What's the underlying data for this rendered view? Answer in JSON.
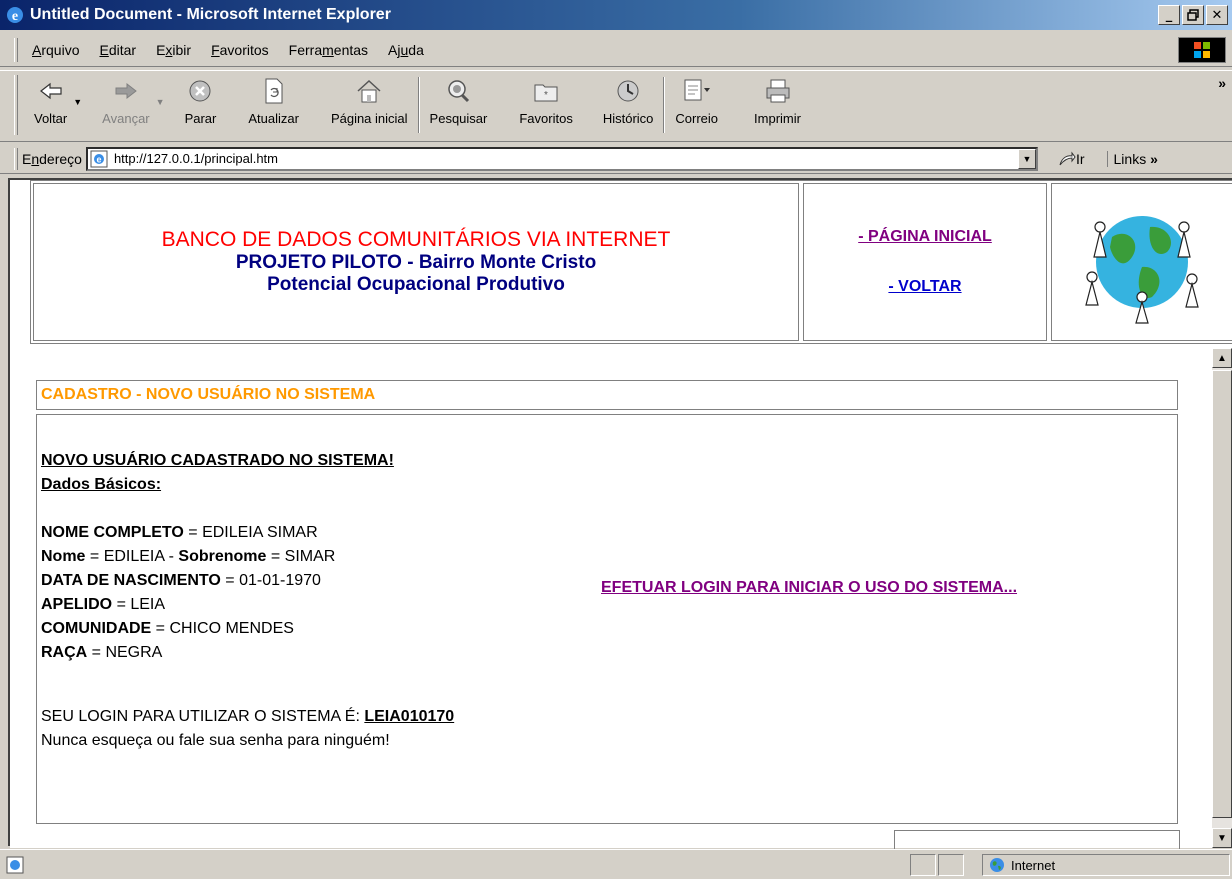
{
  "window": {
    "title": "Untitled Document - Microsoft Internet Explorer",
    "buttons": [
      "_",
      "🗗",
      "X"
    ]
  },
  "menu": {
    "items": [
      {
        "pre": "",
        "u": "A",
        "post": "rquivo"
      },
      {
        "pre": "",
        "u": "E",
        "post": "ditar"
      },
      {
        "pre": "E",
        "u": "x",
        "post": "ibir"
      },
      {
        "pre": "",
        "u": "F",
        "post": "avoritos"
      },
      {
        "pre": "Ferra",
        "u": "m",
        "post": "entas"
      },
      {
        "pre": "Aj",
        "u": "u",
        "post": "da"
      }
    ]
  },
  "toolbar": {
    "back": "Voltar",
    "forward": "Avançar",
    "stop": "Parar",
    "refresh": "Atualizar",
    "home": "Página inicial",
    "search": "Pesquisar",
    "favorites": "Favoritos",
    "history": "Histórico",
    "mail": "Correio",
    "print": "Imprimir"
  },
  "address": {
    "label_pre": "E",
    "label_u": "n",
    "label_post": "dereço",
    "url": "http://127.0.0.1/principal.htm",
    "go": "Ir",
    "links": "Links"
  },
  "header": {
    "title_red": "BANCO DE DADOS COMUNITÁRIOS VIA INTERNET",
    "line2": "PROJETO PILOTO - Bairro Monte Cristo",
    "line3": "Potencial Ocupacional Produtivo",
    "link_home": "- PÁGINA INICIAL",
    "link_back": "- VOLTAR"
  },
  "cadastro": {
    "section_title": "CADASTRO - NOVO USUÁRIO NO SISTEMA",
    "success": "NOVO USUÁRIO CADASTRADO NO SISTEMA! ",
    "basic": "Dados Básicos:",
    "nome_completo_label": "NOME COMPLETO",
    "nome_completo": "EDILEIA SIMAR",
    "nome_label": "Nome",
    "nome": "EDILEIA",
    "sobrenome_label": "Sobrenome",
    "sobrenome": "SIMAR",
    "nasc_label": "DATA DE NASCIMENTO",
    "nasc": "01-01-1970",
    "apelido_label": "APELIDO",
    "apelido": "LEIA",
    "comunidade_label": "COMUNIDADE",
    "comunidade": "CHICO MENDES",
    "raca_label": "RAÇA",
    "raca": "NEGRA",
    "login_text": "SEU LOGIN PARA UTILIZAR O SISTEMA É: ",
    "login": "LEIA010170",
    "warning": "Nunca esqueça ou fale sua senha para ninguém!",
    "login_link": "EFETUAR LOGIN PARA INICIAR O USO DO SISTEMA..."
  },
  "status": {
    "zone": "Internet"
  }
}
